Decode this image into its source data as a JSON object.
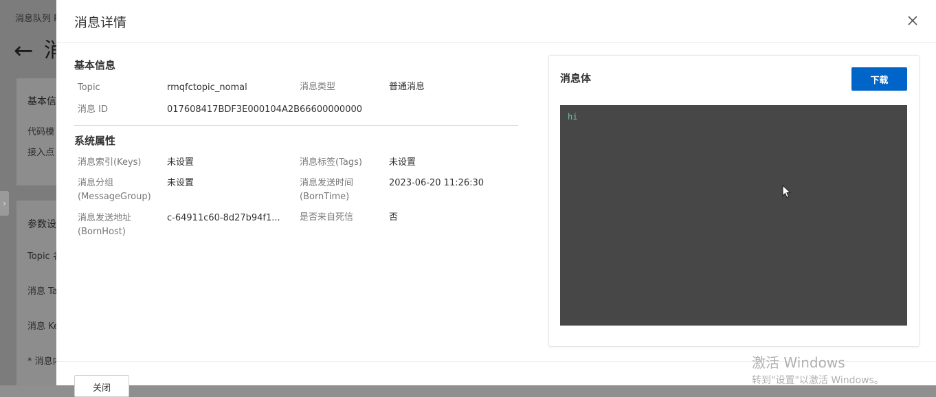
{
  "background": {
    "breadcrumb": "消息队列 R",
    "back_icon": "arrow-left-icon",
    "title_fragment": "消",
    "card1_heading": "基本信",
    "card1_rows": [
      "代码模",
      "接入点"
    ],
    "card2_heading": "参数设",
    "card2_rows": [
      "Topic 名",
      "消息 Ta",
      "消息 Ke",
      "* 消息内"
    ],
    "expander_icon": "chevron-right-icon"
  },
  "drawer": {
    "title": "消息详情",
    "close_icon": "close-icon",
    "basic": {
      "title": "基本信息",
      "topic_label": "Topic",
      "topic_value": "rmqfctopic_nomal",
      "type_label": "消息类型",
      "type_value": "普通消息",
      "id_label": "消息 ID",
      "id_value": "017608417BDF3E000104A2B66600000000"
    },
    "system": {
      "title": "系统属性",
      "keys_label": "消息索引(Keys)",
      "keys_value": "未设置",
      "tags_label": "消息标签(Tags)",
      "tags_value": "未设置",
      "group_label_1": "消息分组",
      "group_label_2": "(MessageGroup)",
      "group_value": "未设置",
      "borntime_label_1": "消息发送时间",
      "borntime_label_2": "(BornTime)",
      "borntime_value": "2023-06-20 11:26:30",
      "bornhost_label_1": "消息发送地址",
      "bornhost_label_2": "(BornHost)",
      "bornhost_value": "c-64911c60-8d27b94f1...",
      "dlq_label": "是否来自死信",
      "dlq_value": "否"
    },
    "body": {
      "title": "消息体",
      "download_label": "下载",
      "content": "hi"
    },
    "footer": {
      "close_label": "关闭"
    }
  },
  "watermark": {
    "line1": "激活 Windows",
    "line2": "转到\"设置\"以激活 Windows。"
  },
  "colors": {
    "primary": "#0064c8",
    "code_bg": "#474747",
    "code_text": "#6fc3a8",
    "overlay": "#7c7c7c"
  }
}
